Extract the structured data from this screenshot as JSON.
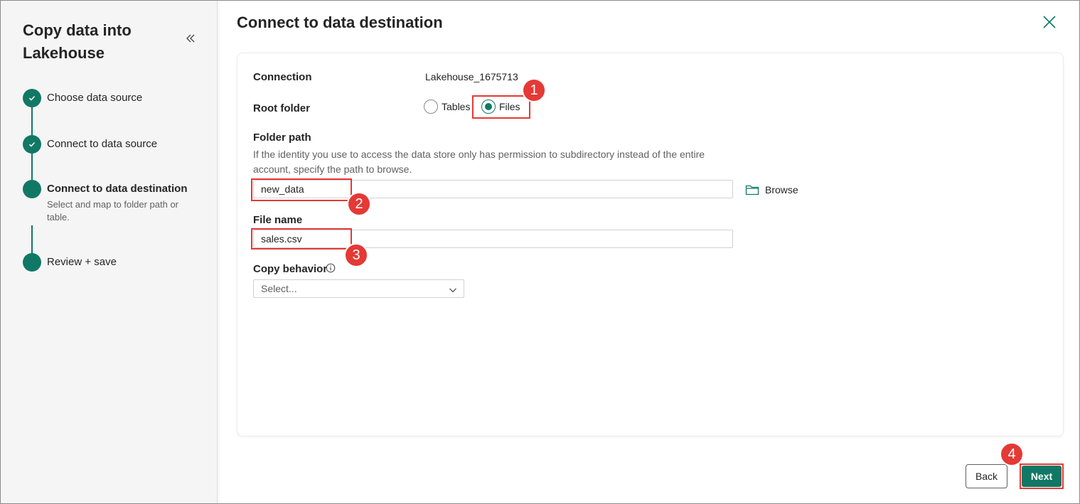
{
  "sidebar": {
    "title": "Copy data into Lakehouse",
    "steps": [
      {
        "label": "Choose data source",
        "status": "done"
      },
      {
        "label": "Connect to data source",
        "status": "done"
      },
      {
        "label": "Connect to data destination",
        "status": "current",
        "description": "Select and map to folder path or table."
      },
      {
        "label": "Review + save",
        "status": "pending"
      }
    ]
  },
  "main": {
    "title": "Connect to data destination",
    "connection": {
      "label": "Connection",
      "value": "Lakehouse_1675713"
    },
    "root_folder": {
      "label": "Root folder",
      "options": [
        {
          "label": "Tables",
          "selected": false
        },
        {
          "label": "Files",
          "selected": true
        }
      ]
    },
    "folder_path": {
      "label": "Folder path",
      "helper": "If the identity you use to access the data store only has permission to subdirectory instead of the entire account, specify the path to browse.",
      "value": "new_data",
      "browse_label": "Browse"
    },
    "file_name": {
      "label": "File name",
      "value": "sales.csv"
    },
    "copy_behavior": {
      "label": "Copy behavior",
      "placeholder": "Select..."
    }
  },
  "footer": {
    "back_label": "Back",
    "next_label": "Next"
  },
  "annotations": [
    "1",
    "2",
    "3",
    "4"
  ],
  "colors": {
    "accent": "#117865",
    "callout": "#e53935"
  }
}
